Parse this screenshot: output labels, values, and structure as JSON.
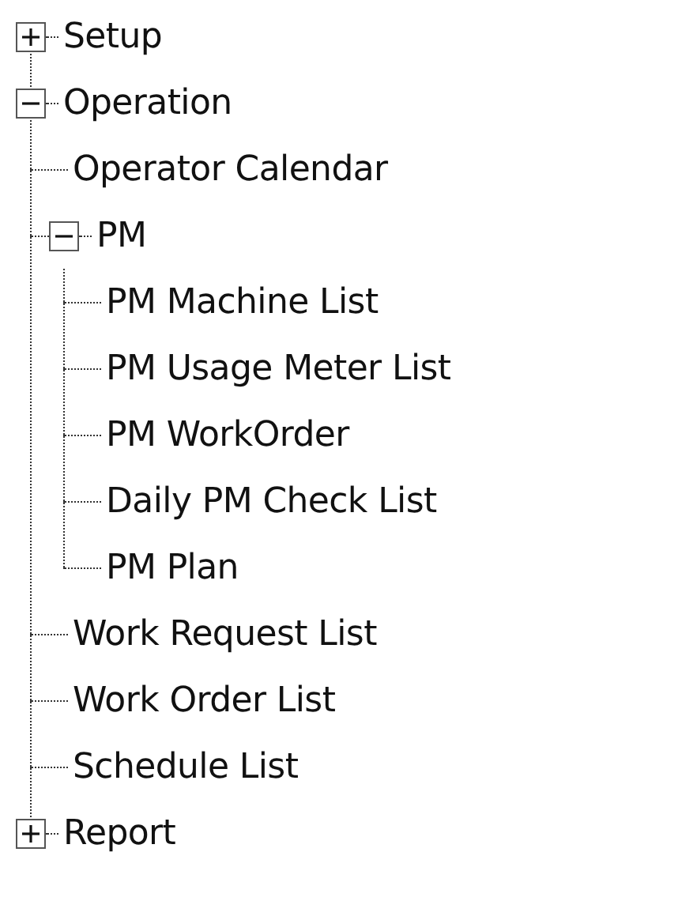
{
  "tree": [
    {
      "label": "Setup",
      "expanded": false
    },
    {
      "label": "Operation",
      "expanded": true,
      "children": [
        {
          "label": "Operator Calendar"
        },
        {
          "label": "PM",
          "expanded": true,
          "children": [
            {
              "label": "PM Machine List"
            },
            {
              "label": "PM Usage Meter List"
            },
            {
              "label": "PM WorkOrder"
            },
            {
              "label": "Daily PM Check List"
            },
            {
              "label": "PM Plan"
            }
          ]
        },
        {
          "label": "Work Request List"
        },
        {
          "label": "Work Order List"
        },
        {
          "label": "Schedule List"
        }
      ]
    },
    {
      "label": "Report",
      "expanded": false
    }
  ]
}
